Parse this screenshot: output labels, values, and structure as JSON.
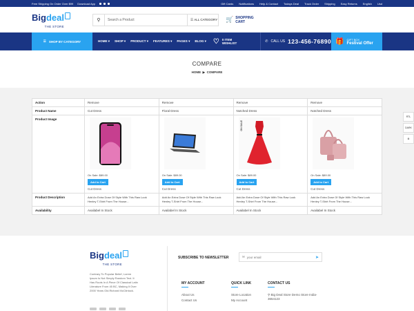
{
  "topbar": {
    "shipping": "Free Shipping On Order Over $99",
    "download": "Download App",
    "links": [
      "Gift Cards",
      "Notifications",
      "Help & Contact",
      "Todays Deal",
      "Track Order",
      "Shipping",
      "Easy Returns",
      "English",
      "Usd"
    ]
  },
  "header": {
    "logo_big": "Big",
    "logo_deal": "deal",
    "logo_sub": "THE STORE",
    "search_placeholder": "Search a Product",
    "category_label": "ALL CATEGORY",
    "cart_line1": "SHOPPING",
    "cart_line2": "CART"
  },
  "nav": {
    "shop_by_category": "SHOP BY CATEGORY",
    "items": [
      "HOME",
      "SHOP",
      "PRODUCT",
      "FEATURES",
      "PAGES",
      "BLOG"
    ],
    "wishlist_count": "0 ITEM",
    "wishlist_label": "WISHLIST",
    "call_label": "CALL US",
    "phone": "123-456-76890",
    "gift_line1": "GIFT BOX",
    "gift_line2": "Festival Offer"
  },
  "page": {
    "title": "COMPARE",
    "breadcrumb_home": "HOME",
    "breadcrumb_current": "COMPARE"
  },
  "compare": {
    "labels": {
      "action": "Action",
      "name": "Product Name",
      "image": "Product Image",
      "description": "Product Description",
      "availability": "Availability"
    },
    "products": [
      {
        "action": "Remove",
        "name": "Cut Dress",
        "price": "On Sale: $89.00",
        "button": "Add to Cart",
        "subname": "Cut Dress",
        "description": "Add An Extra Dose Of Style With This Raw Look Henley T-Shirt From The House...",
        "availability": "Availabel In Stock"
      },
      {
        "action": "Remove",
        "name": "Floral Dress",
        "price": "On Sale: $89.00",
        "button": "Add to Cart",
        "subname": "Cut Dress",
        "description": "Add An Extra Dose Of Style With This Raw Look Henley T-Shirt From The House...",
        "availability": "Availabel In Stock"
      },
      {
        "action": "Remove",
        "name": "Notched Dress",
        "price": "On Sale: $89.00",
        "button": "Add to Cart",
        "subname": "Cut Dress",
        "description": "Add An Extra Dose Of Style With This Raw Look Henley T-Shirt From The House...",
        "availability": "Availabel In Stock",
        "badge": "ON SALE"
      },
      {
        "action": "Remove",
        "name": "Notched Dress",
        "price": "On Sale: $89.00",
        "button": "Add to Cart",
        "subname": "Cut Dress",
        "description": "Add An Extra Dose Of Style With This Raw Look Henley T-Shirt From The House...",
        "availability": "Availabel In Stock"
      }
    ]
  },
  "side": {
    "rtl": "RTL",
    "dark": "DARK"
  },
  "footer": {
    "about": "Contrary To Popular Belief, Lorem Ipsum Is Not Simply Random Text. It Has Roots In A Piece Of Classical Latin Literature From 45 BC, Making It Over 2000 Years Old.Richard McClintock.",
    "newsletter": "SUBSCRIBE TO NEWSLETTER",
    "email_placeholder": "your email",
    "my_account": "MY ACCOUNT",
    "my_account_items": [
      "About Us",
      "Contact Us"
    ],
    "quick_link": "QUICK LINK",
    "quick_link_items": [
      "Store Location",
      "My Account"
    ],
    "contact": "CONTACT US",
    "contact_items": [
      "Big Deal Store Demo Store India-3654123"
    ]
  },
  "colors": {
    "primary": "#1a3584",
    "accent": "#29a3f0"
  }
}
